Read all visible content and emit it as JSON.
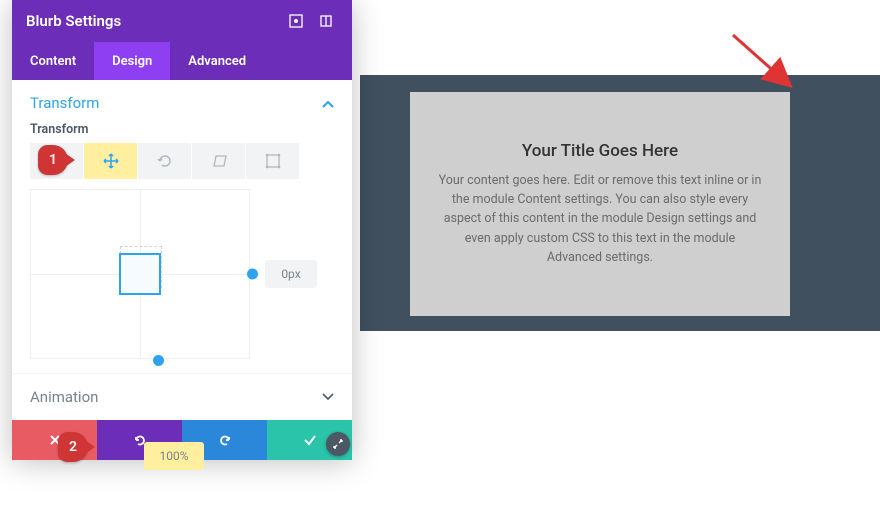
{
  "panel": {
    "title": "Blurb Settings",
    "tabs": [
      "Content",
      "Design",
      "Advanced"
    ],
    "active_tab_index": 1,
    "section": {
      "title": "Transform",
      "label": "Transform",
      "controls": [
        "scale",
        "move",
        "rotate",
        "skew",
        "origin"
      ],
      "active_control_index": 1,
      "x_value": "0px",
      "y_value": "100%"
    },
    "next_section": "Animation"
  },
  "preview": {
    "title": "Your Title Goes Here",
    "body": "Your content goes here. Edit or remove this text inline or in the module Content settings. You can also style every aspect of this content in the module Design settings and even apply custom CSS to this text in the module Advanced settings."
  },
  "annotations": {
    "steps": [
      "1",
      "2"
    ]
  },
  "footer": {
    "close": "✕",
    "undo": "↺",
    "redo": "↻",
    "save": "✓"
  },
  "colors": {
    "primary": "#6c2eb9",
    "accent": "#2ea3f2",
    "tab_active": "#8e3ff1",
    "highlight": "#ffef9e",
    "badge": "#d03535"
  }
}
